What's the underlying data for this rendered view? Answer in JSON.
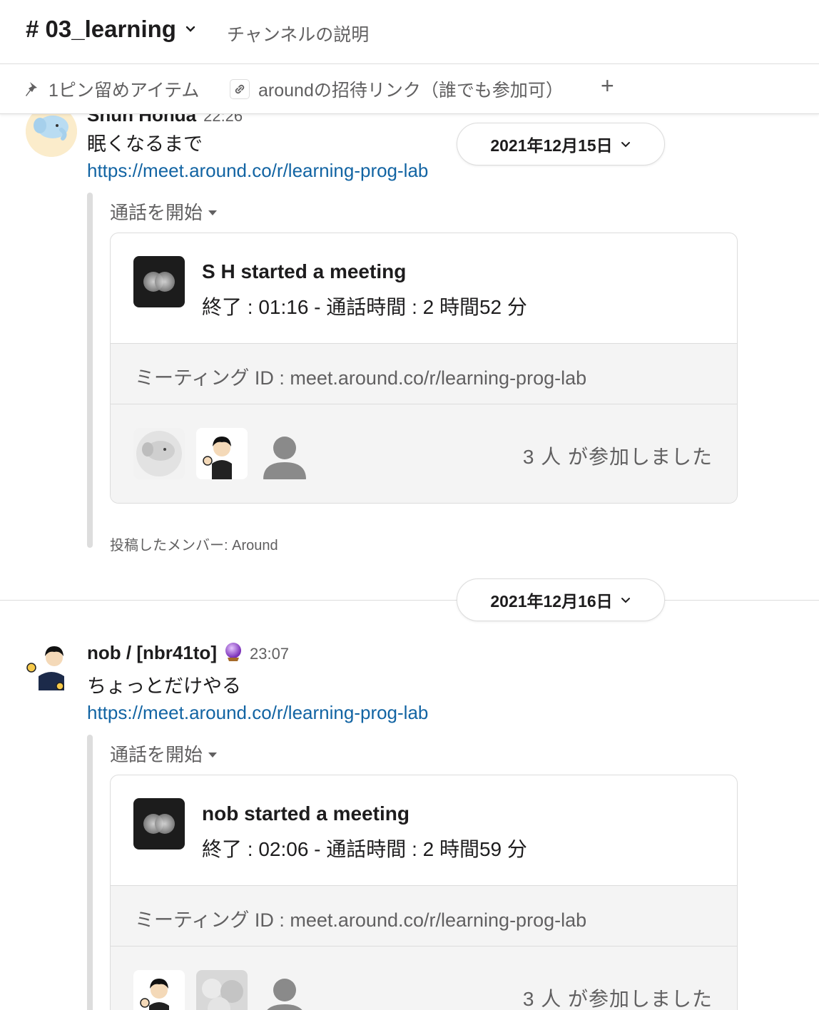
{
  "header": {
    "channel": "# 03_learning",
    "description": "チャンネルの説明"
  },
  "bookmarks": {
    "pinned": "1ピン留めアイテム",
    "link": "aroundの招待リンク（誰でも参加可）",
    "add": "+"
  },
  "dates": {
    "first": "2021年12月15日",
    "second": "2021年12月16日"
  },
  "messages": [
    {
      "author": "Shun Honda",
      "time": "22:26",
      "text": "眠くなるまで",
      "link": "https://meet.around.co/r/learning-prog-lab",
      "call_button": "通話を開始",
      "card": {
        "title": "S H started a meeting",
        "subtitle": "終了 : 01:16 - 通話時間 : 2 時間52 分",
        "meeting_id": "ミーティング ID : meet.around.co/r/learning-prog-lab",
        "joined": "3 人 が参加しました"
      },
      "posted_by": "投稿したメンバー: Around"
    },
    {
      "author": "nob / [nbr41to]",
      "time": "23:07",
      "text": "ちょっとだけやる",
      "link": "https://meet.around.co/r/learning-prog-lab",
      "call_button": "通話を開始",
      "card": {
        "title": "nob started a meeting",
        "subtitle": "終了 : 02:06 - 通話時間 : 2 時間59 分",
        "meeting_id": "ミーティング ID : meet.around.co/r/learning-prog-lab",
        "joined": "3 人 が参加しました"
      }
    }
  ],
  "icons": {
    "pin": "pin-icon",
    "link": "link-icon",
    "chevron": "chevron-down-icon",
    "status": "crystal-ball-icon",
    "around_logo": "around-logo-icon"
  },
  "colors": {
    "link": "#1264a3",
    "muted": "#616061",
    "card_bg": "#f4f4f4"
  }
}
